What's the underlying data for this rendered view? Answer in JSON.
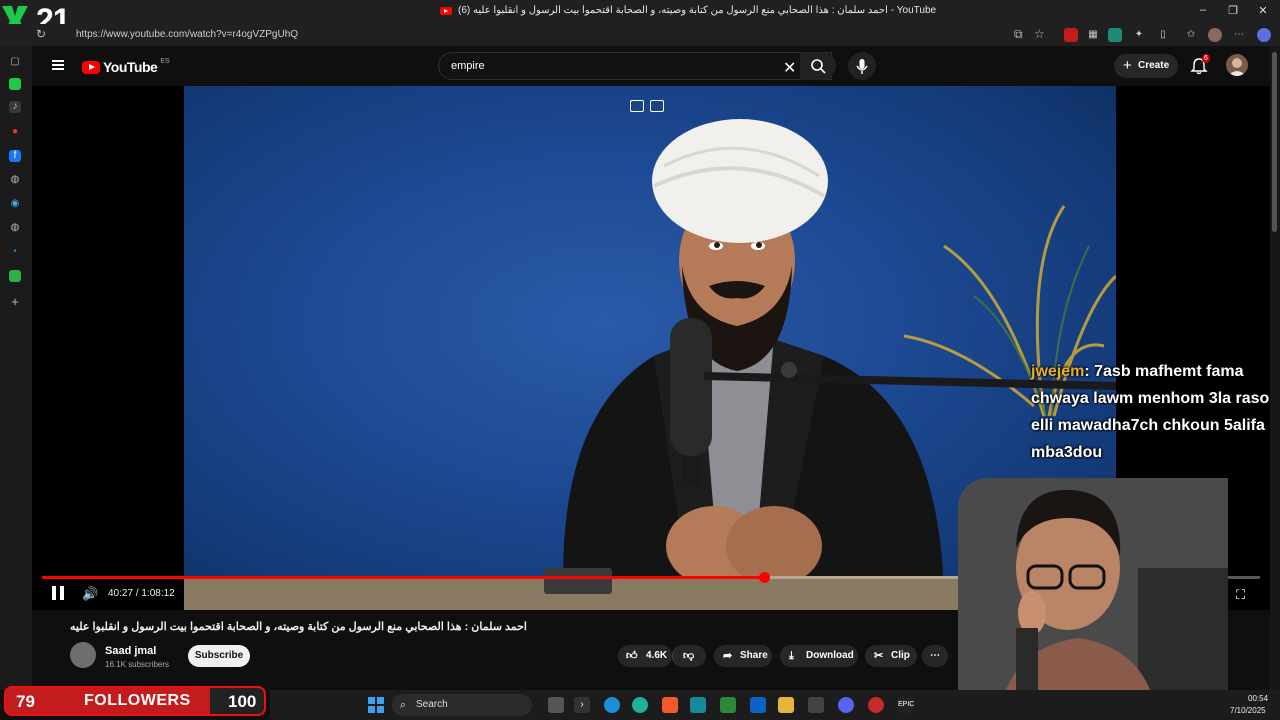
{
  "browser": {
    "tab_title": "(6) احمد سلمان : هذا الصحابي منع الرسول من كتابة وصيته، و الصحابة اقتحموا بيت الرسول و انقلبوا عليه - YouTube",
    "url": "https://www.youtube.com/watch?v=r4ogVZPgUhQ"
  },
  "stream_overlay": {
    "counter": "21",
    "followers_current": "79",
    "followers_label": "FOLLOWERS",
    "followers_goal": "100",
    "followers_progress": 0.79
  },
  "youtube": {
    "wordmark": "YouTube",
    "region": "ES",
    "search_value": "empire",
    "create_label": "Create",
    "notifications_count": "6"
  },
  "player": {
    "time": "40:27 / 1:08:12",
    "progress": 0.593
  },
  "chat": {
    "user": "jwejem",
    "message": ": 7asb mafhemt fama chwaya lawm menhom 3la rasoul elli mawadha7ch chkoun 5alifa mba3dou"
  },
  "video": {
    "title": "احمد سلمان : هذا الصحابي منع الرسول من كتابة وصيته، و الصحابة اقتحموا بيت الرسول و انقلبوا عليه",
    "channel_name": "Saad jmal",
    "subscribers": "16.1K subscribers",
    "subscribe_label": "Subscribe",
    "likes": "4.6K",
    "share_label": "Share",
    "download_label": "Download",
    "clip_label": "Clip"
  },
  "taskbar": {
    "search_label": "Search",
    "time": "00:54",
    "date": "7/10/2025"
  },
  "colors": {
    "yt_red": "#ff0000",
    "chat_user": "#e6b02a",
    "followers_bar": "#c41c1c"
  }
}
